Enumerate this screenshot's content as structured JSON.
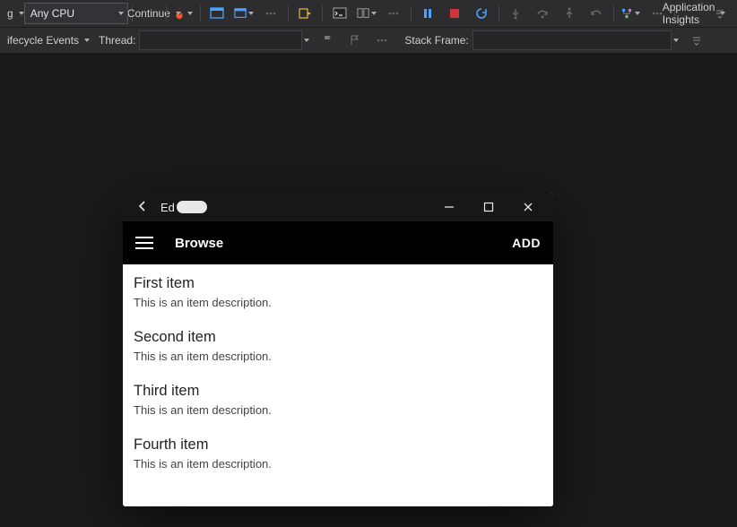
{
  "toolbar": {
    "config_combo_left_fragment": "g",
    "platform_combo": "Any CPU",
    "continue_label": "Continue",
    "appinsights_label": "Application Insights"
  },
  "toolbar2": {
    "lifecycle_label_fragment": "ifecycle Events",
    "thread_label": "Thread:",
    "stackframe_label": "Stack Frame:"
  },
  "appwindow": {
    "title_prefix": "Ed",
    "header_title": "Browse",
    "add_label": "ADD",
    "items": [
      {
        "title": "First item",
        "desc": "This is an item description."
      },
      {
        "title": "Second item",
        "desc": "This is an item description."
      },
      {
        "title": "Third item",
        "desc": "This is an item description."
      },
      {
        "title": "Fourth item",
        "desc": "This is an item description."
      }
    ]
  }
}
